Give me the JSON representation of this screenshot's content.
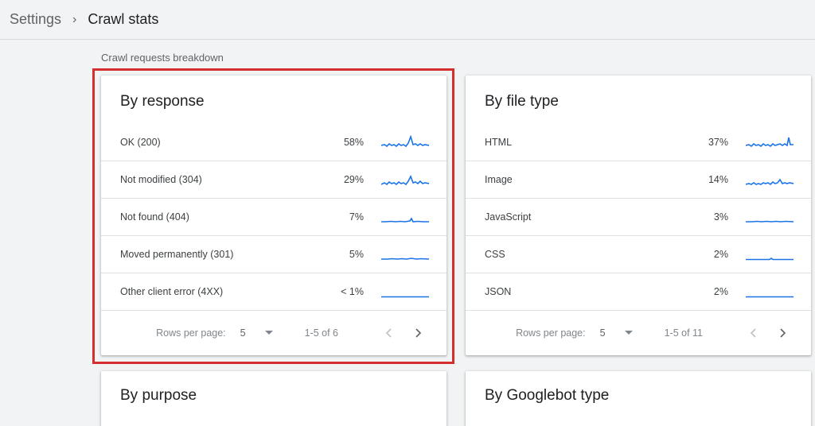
{
  "breadcrumb": {
    "parent": "Settings",
    "separator": "›",
    "current": "Crawl stats"
  },
  "section_label": "Crawl requests breakdown",
  "cards": {
    "by_response": {
      "title": "By response",
      "rows": [
        {
          "label": "OK (200)",
          "pct": "58%"
        },
        {
          "label": "Not modified (304)",
          "pct": "29%"
        },
        {
          "label": "Not found (404)",
          "pct": "7%"
        },
        {
          "label": "Moved permanently (301)",
          "pct": "5%"
        },
        {
          "label": "Other client error (4XX)",
          "pct": "< 1%"
        }
      ],
      "pager": {
        "rows_per_page_label": "Rows per page:",
        "rows_per_page": "5",
        "range": "1-5 of 6"
      }
    },
    "by_file_type": {
      "title": "By file type",
      "rows": [
        {
          "label": "HTML",
          "pct": "37%"
        },
        {
          "label": "Image",
          "pct": "14%"
        },
        {
          "label": "JavaScript",
          "pct": "3%"
        },
        {
          "label": "CSS",
          "pct": "2%"
        },
        {
          "label": "JSON",
          "pct": "2%"
        }
      ],
      "pager": {
        "rows_per_page_label": "Rows per page:",
        "rows_per_page": "5",
        "range": "1-5 of 11"
      }
    },
    "by_purpose": {
      "title": "By purpose"
    },
    "by_googlebot_type": {
      "title": "By Googlebot type"
    }
  },
  "icons": {
    "prev": "chevron-left-icon",
    "next": "chevron-right-icon",
    "dropdown": "arrow-drop-down-icon"
  },
  "colors": {
    "accent": "#1a73e8",
    "highlight": "#d32f2f"
  }
}
